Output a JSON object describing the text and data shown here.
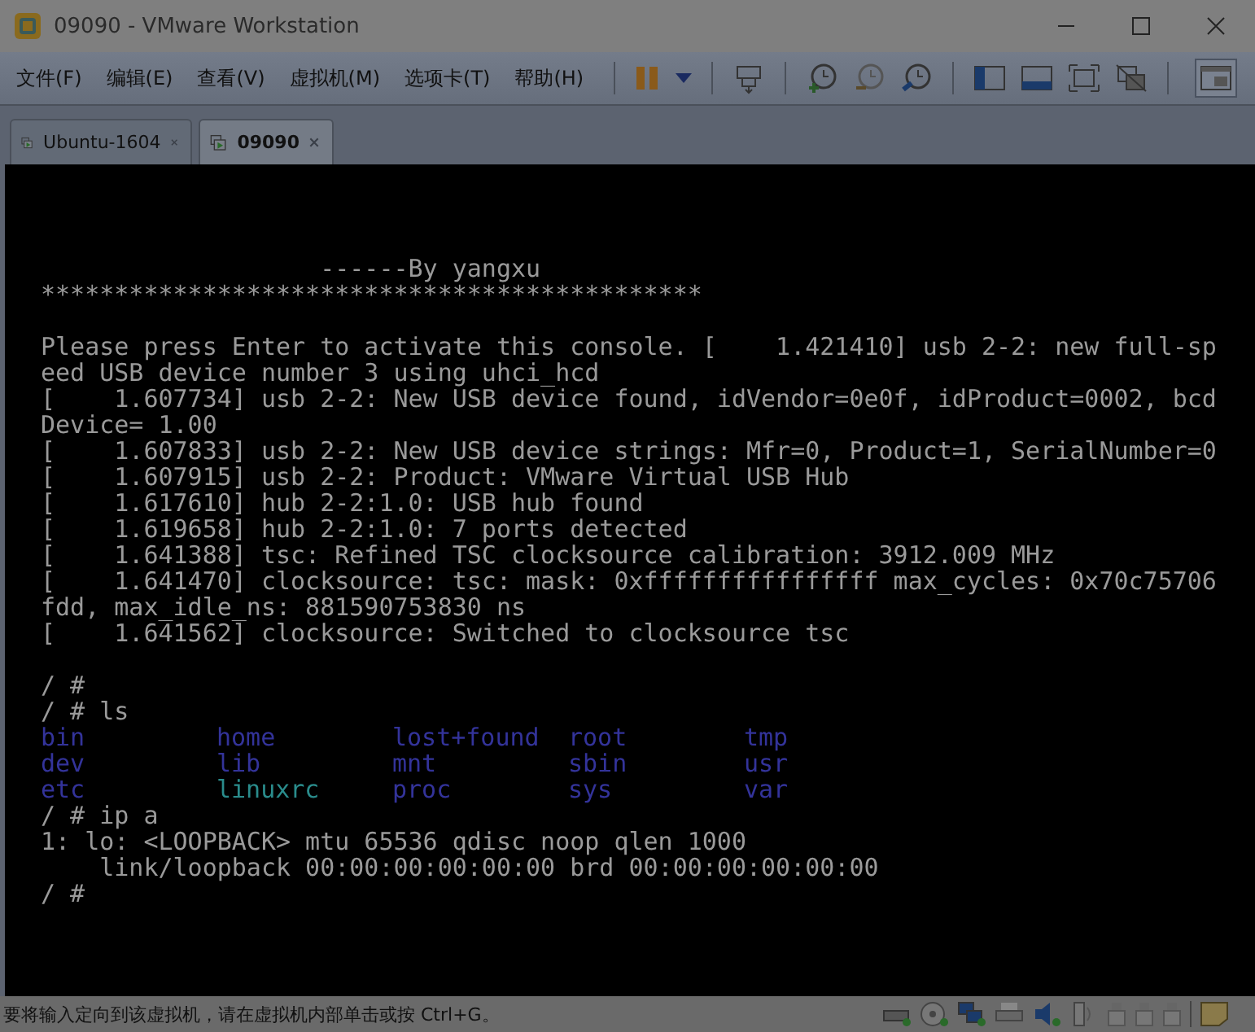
{
  "window": {
    "title": "09090 - VMware Workstation"
  },
  "menu": [
    "文件(F)",
    "编辑(E)",
    "查看(V)",
    "虚拟机(M)",
    "选项卡(T)",
    "帮助(H)"
  ],
  "tabs": [
    {
      "label": "Ubuntu-1604",
      "selected": false
    },
    {
      "label": "09090",
      "selected": true
    }
  ],
  "console": [
    {
      "kind": "blank"
    },
    {
      "kind": "blank"
    },
    {
      "kind": "text",
      "text": "                   ------By yangxu"
    },
    {
      "kind": "text",
      "text": "*********************************************"
    },
    {
      "kind": "blank"
    },
    {
      "kind": "text",
      "text": "Please press Enter to activate this console. [    1.421410] usb 2-2: new full-sp"
    },
    {
      "kind": "text",
      "text": "eed USB device number 3 using uhci_hcd"
    },
    {
      "kind": "text",
      "text": "[    1.607734] usb 2-2: New USB device found, idVendor=0e0f, idProduct=0002, bcd"
    },
    {
      "kind": "text",
      "text": "Device= 1.00"
    },
    {
      "kind": "text",
      "text": "[    1.607833] usb 2-2: New USB device strings: Mfr=0, Product=1, SerialNumber=0"
    },
    {
      "kind": "text",
      "text": "[    1.607915] usb 2-2: Product: VMware Virtual USB Hub"
    },
    {
      "kind": "text",
      "text": "[    1.617610] hub 2-2:1.0: USB hub found"
    },
    {
      "kind": "text",
      "text": "[    1.619658] hub 2-2:1.0: 7 ports detected"
    },
    {
      "kind": "text",
      "text": "[    1.641388] tsc: Refined TSC clocksource calibration: 3912.009 MHz"
    },
    {
      "kind": "text",
      "text": "[    1.641470] clocksource: tsc: mask: 0xffffffffffffffff max_cycles: 0x70c75706"
    },
    {
      "kind": "text",
      "text": "fdd, max_idle_ns: 881590753830 ns"
    },
    {
      "kind": "text",
      "text": "[    1.641562] clocksource: Switched to clocksource tsc"
    },
    {
      "kind": "blank"
    },
    {
      "kind": "text",
      "text": "/ #"
    },
    {
      "kind": "text",
      "text": "/ # ls"
    },
    {
      "kind": "ls",
      "entries": [
        {
          "name": "bin",
          "color": "#33339a"
        },
        {
          "name": "home",
          "color": "#33339a"
        },
        {
          "name": "lost+found",
          "color": "#33339a"
        },
        {
          "name": "root",
          "color": "#33339a"
        },
        {
          "name": "tmp",
          "color": "#33339a"
        }
      ]
    },
    {
      "kind": "ls",
      "entries": [
        {
          "name": "dev",
          "color": "#33339a"
        },
        {
          "name": "lib",
          "color": "#33339a"
        },
        {
          "name": "mnt",
          "color": "#33339a"
        },
        {
          "name": "sbin",
          "color": "#33339a"
        },
        {
          "name": "usr",
          "color": "#33339a"
        }
      ]
    },
    {
      "kind": "ls",
      "entries": [
        {
          "name": "etc",
          "color": "#33339a"
        },
        {
          "name": "linuxrc",
          "color": "#2a8c8c"
        },
        {
          "name": "proc",
          "color": "#33339a"
        },
        {
          "name": "sys",
          "color": "#33339a"
        },
        {
          "name": "var",
          "color": "#33339a"
        }
      ]
    },
    {
      "kind": "text",
      "text": "/ # ip a"
    },
    {
      "kind": "text",
      "text": "1: lo: <LOOPBACK> mtu 65536 qdisc noop qlen 1000"
    },
    {
      "kind": "text",
      "text": "    link/loopback 00:00:00:00:00:00 brd 00:00:00:00:00:00"
    },
    {
      "kind": "text",
      "text": "/ #"
    }
  ],
  "status_bar": {
    "text": "要将输入定向到该虚拟机，请在虚拟机内部单击或按 Ctrl+G。"
  }
}
